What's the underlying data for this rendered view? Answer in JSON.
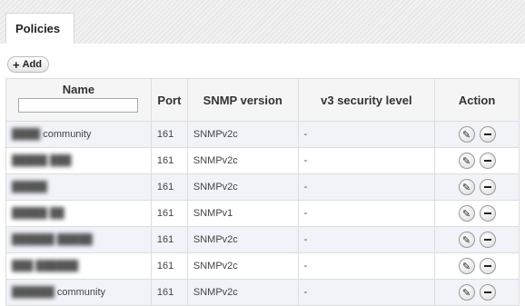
{
  "tabs": {
    "policies": "Policies"
  },
  "toolbar": {
    "add_label": "Add"
  },
  "table": {
    "headers": {
      "name": "Name",
      "port": "Port",
      "snmp_version": "SNMP version",
      "v3_security_level": "v3 security level",
      "action": "Action"
    },
    "filter": {
      "value": ""
    },
    "rows": [
      {
        "name_hidden": "████",
        "name_visible": "community",
        "port": "161",
        "snmp_version": "SNMPv2c",
        "v3_security_level": "-"
      },
      {
        "name_hidden": "█████ ███",
        "name_visible": "",
        "port": "161",
        "snmp_version": "SNMPv2c",
        "v3_security_level": "-"
      },
      {
        "name_hidden": "█████",
        "name_visible": "",
        "port": "161",
        "snmp_version": "SNMPv2c",
        "v3_security_level": "-"
      },
      {
        "name_hidden": "█████ ██",
        "name_visible": "",
        "port": "161",
        "snmp_version": "SNMPv1",
        "v3_security_level": "-"
      },
      {
        "name_hidden": "██████ █████",
        "name_visible": "",
        "port": "161",
        "snmp_version": "SNMPv2c",
        "v3_security_level": "-"
      },
      {
        "name_hidden": "███ ██████",
        "name_visible": "",
        "port": "161",
        "snmp_version": "SNMPv2c",
        "v3_security_level": "-"
      },
      {
        "name_hidden": "██████",
        "name_visible": "community",
        "port": "161",
        "snmp_version": "SNMPv2c",
        "v3_security_level": "-"
      }
    ]
  },
  "icons": {
    "edit": "pencil-icon",
    "remove": "minus-icon",
    "add": "plus-icon"
  }
}
